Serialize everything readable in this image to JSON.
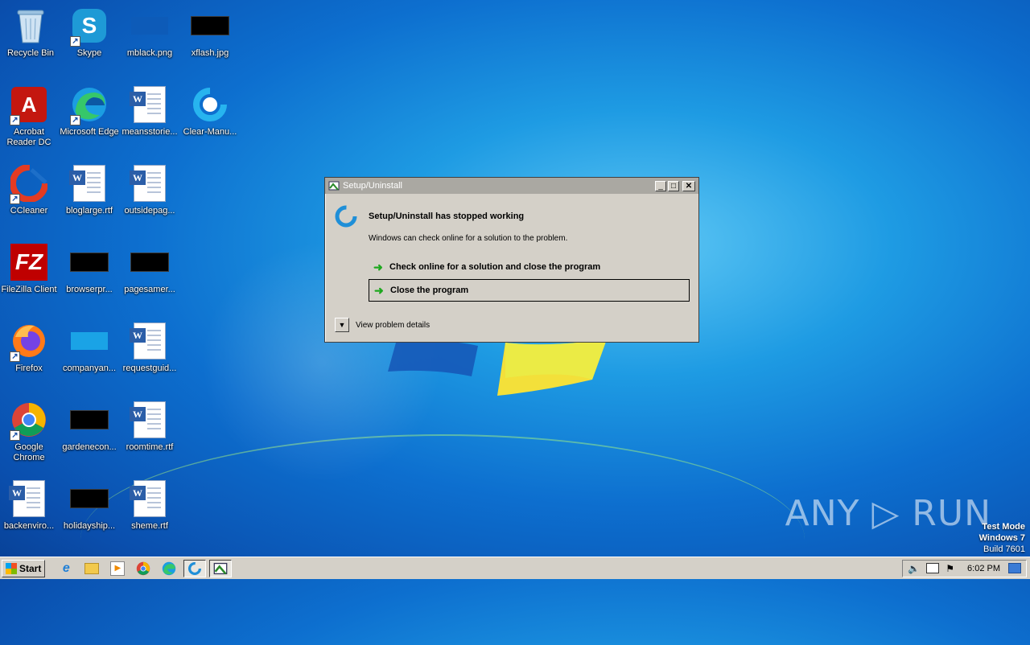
{
  "desktop": {
    "icons": [
      {
        "label": "Recycle Bin",
        "icon": "recycle-bin-icon"
      },
      {
        "label": "Skype",
        "icon": "skype-icon"
      },
      {
        "label": "mblack.png",
        "icon": "image-file-icon"
      },
      {
        "label": "xflash.jpg",
        "icon": "image-file-icon"
      },
      {
        "label": "Acrobat Reader DC",
        "icon": "acrobat-icon"
      },
      {
        "label": "Microsoft Edge",
        "icon": "edge-icon"
      },
      {
        "label": "meansstorie...",
        "icon": "word-doc-icon"
      },
      {
        "label": "Clear-Manu...",
        "icon": "ccleaner-setup-icon"
      },
      {
        "label": "CCleaner",
        "icon": "ccleaner-icon"
      },
      {
        "label": "bloglarge.rtf",
        "icon": "word-doc-icon"
      },
      {
        "label": "outsidepag...",
        "icon": "word-doc-icon"
      },
      {
        "label": "FileZilla Client",
        "icon": "filezilla-icon"
      },
      {
        "label": "browserpr...",
        "icon": "image-file-icon"
      },
      {
        "label": "pagesamer...",
        "icon": "image-file-icon"
      },
      {
        "label": "Firefox",
        "icon": "firefox-icon"
      },
      {
        "label": "companyan...",
        "icon": "image-file-icon"
      },
      {
        "label": "requestguid...",
        "icon": "word-doc-icon"
      },
      {
        "label": "Google Chrome",
        "icon": "chrome-icon"
      },
      {
        "label": "gardenecon...",
        "icon": "image-file-icon"
      },
      {
        "label": "roomtime.rtf",
        "icon": "word-doc-icon"
      },
      {
        "label": "backenviro...",
        "icon": "word-doc-icon"
      },
      {
        "label": "holidayship...",
        "icon": "image-file-icon"
      },
      {
        "label": "sheme.rtf",
        "icon": "word-doc-icon"
      }
    ]
  },
  "dialog": {
    "window_title": "Setup/Uninstall",
    "heading": "Setup/Uninstall has stopped working",
    "subtext": "Windows can check online for a solution to the problem.",
    "option_check": "Check online for a solution and close the program",
    "option_close": "Close the program",
    "details": "View problem details",
    "minimize": "_",
    "maximize": "□",
    "close": "✕"
  },
  "watermark": {
    "brand": "ANY ▷ RUN",
    "mode": "Test Mode",
    "os": "Windows 7",
    "build": "Build 7601"
  },
  "taskbar": {
    "start_label": "Start",
    "clock": "6:02 PM"
  },
  "colors": {
    "accent_green": "#1fa81f",
    "desktop_blue": "#0d6fcf"
  }
}
